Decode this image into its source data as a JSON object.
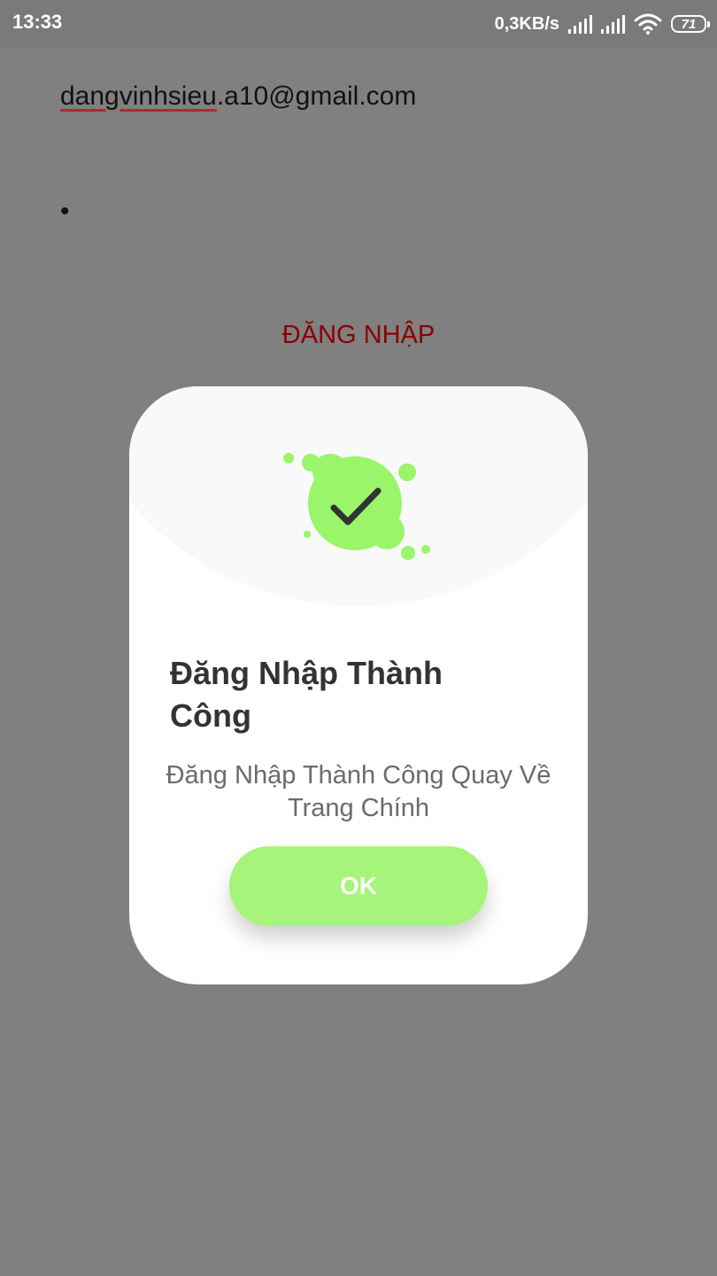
{
  "status_bar": {
    "time": "13:33",
    "net_speed": "0,3KB/s",
    "battery": "71"
  },
  "form": {
    "email_value": "dangvinhsieu.a10@gmail.com",
    "email_misspelled_part": "dangvinhsieu",
    "email_rest": ".a10@gmail.com",
    "password_value": "•",
    "login_button_label": "ĐĂNG NHẬP"
  },
  "dialog": {
    "title": "Đăng Nhập Thành Công",
    "message": "Đăng Nhập Thành Công Quay Về Trang Chính",
    "ok_label": "OK",
    "icon": "success-check-icon"
  },
  "colors": {
    "overlay_background": "#808080",
    "login_text": "#8b0000",
    "success_green": "#9af56b",
    "ok_button": "#a6f479"
  }
}
